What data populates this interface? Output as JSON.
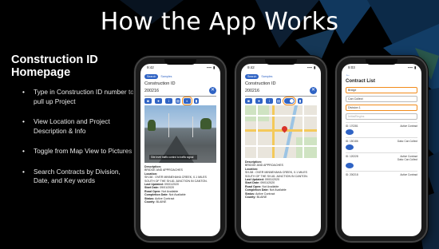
{
  "slide": {
    "title": "How the App Works",
    "heading": "Construction ID Homepage"
  },
  "bullets": [
    "Type in Construction ID number to pull up Project",
    "View Location and Project Description & Info",
    "Toggle from Map View to Pictures",
    "Search Contracts by Division, Date, and Key words"
  ],
  "phone1": {
    "time": "9:42",
    "tab_active": "Search",
    "tab_other": "Samples",
    "label": "Construction ID",
    "id": "200216",
    "photo_caption": "Site level traffic control to traffic signal",
    "desc": {
      "description_label": "Description:",
      "description": "BRIDGE AND APPROACHES",
      "location_label": "Location:",
      "location": "SH-58 : OVER MINNEHAHA CREEK, 0.1 MILES SOUTH OF THE SH-81 JUNCTION IN CANTON.",
      "updated_label": "Last Updated:",
      "updated": "09/01/2020",
      "start_label": "Start Date:",
      "start": "09/01/2020",
      "road_label": "Road Open:",
      "road": "Not Available",
      "completion_label": "Completion Date:",
      "completion": "Not Available",
      "status_label": "Status:",
      "status": "Active Contract",
      "county_label": "County:",
      "county": "BLAINE"
    }
  },
  "phone2": {
    "time": "9:42",
    "tab_active": "Search",
    "tab_other": "Samples",
    "label": "Construction ID",
    "id": "200216",
    "desc": {
      "description_label": "Description:",
      "description": "BRIDGE AND APPROACHES",
      "location_label": "Location:",
      "location": "SH-58 : OVER MINNEHAHA CREEK, 0.1 MILES SOUTH OF THE SH-81 JUNCTION IN CANTON.",
      "updated_label": "Last Updated:",
      "updated": "09/01/2020",
      "start_label": "Start Date:",
      "start": "09/01/2020",
      "road_label": "Road Open:",
      "road": "Not Available",
      "completion_label": "Completion Date:",
      "completion": "Not Available",
      "status_label": "Status:",
      "status": "Active Contract",
      "county_label": "County:",
      "county": "BLAINE"
    }
  },
  "phone3": {
    "time": "9:03",
    "title": "Contract List",
    "inputs": [
      "Bridge",
      "Can Collect",
      "Division 1",
      "Initial/Begins"
    ],
    "rows": [
      {
        "id": "ID: 170281",
        "status": "Active Contract",
        "note": ""
      },
      {
        "id": "ID: 150186",
        "status": "",
        "note": "Data: Can Collect"
      },
      {
        "id": "ID: 120228",
        "status": "Active Contract",
        "note": "Data: Can Collect"
      },
      {
        "id": "ID: 200218",
        "status": "Active Contract",
        "note": ""
      }
    ]
  },
  "colors": {
    "app_blue": "#2f63c4",
    "highlight_orange": "#f28b1a"
  }
}
